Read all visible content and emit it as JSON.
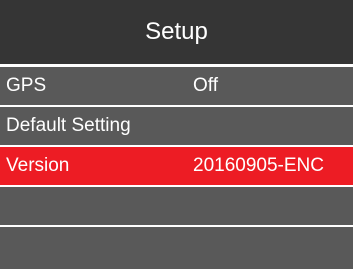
{
  "header": {
    "title": "Setup"
  },
  "menu": {
    "items": [
      {
        "label": "GPS",
        "value": "Off"
      },
      {
        "label": "Default Setting",
        "value": ""
      },
      {
        "label": "Version",
        "value": "20160905-ENC"
      },
      {
        "label": "",
        "value": ""
      },
      {
        "label": "",
        "value": ""
      }
    ],
    "selected_index": 2
  },
  "colors": {
    "header_bg": "#353535",
    "row_bg": "#595959",
    "selected_bg": "#ed1c24",
    "text": "#ffffff",
    "separator": "#ffffff"
  }
}
